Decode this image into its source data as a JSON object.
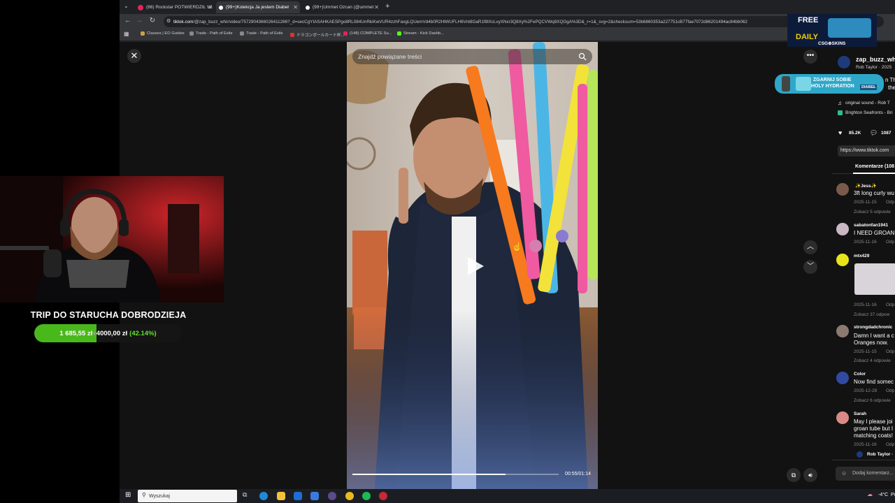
{
  "browser": {
    "tabs": [
      {
        "label": "(86) Rockstar POTWIERDZIŁ Wi",
        "icon_color": "#e0245e"
      },
      {
        "label": "(99+)Kolekcja Ja jestem Diabeł",
        "icon_color": "#ffffff"
      },
      {
        "label": "(99+)Ummet Ozcan (@ummet",
        "icon_color": "#ffffff"
      }
    ],
    "url_host": "tiktok.com",
    "url_path": "/@zap_buzz_whir/video/7572904366026411286?_d=secCgYIASAHKAESPgo8RL084UnRkiKwVUR4zzhFaxgLQUemVd4b0R2HlWUFLH6Vnt8GaR1f8lXcLvyXNxr3Q8Xy%2FePQCVWq9XQGgA%3D&_r=1&_svg=2&checksum=53b6860353a227751cB77fae7072d86201494ac84bb062",
    "bookmarks": [
      "Classes | EO Guides",
      "Trade - Path of Exile",
      "Trade - Path of Exile",
      "ドラゴンボールカード杯...",
      "(148) COMPLETE Su...",
      "Stream - Kick Dashb..."
    ]
  },
  "tiktok": {
    "search_placeholder": "Znajdź powiązane treści",
    "video_time": "00:55/01:14",
    "progress_fraction": 0.743,
    "author_handle": "zap_buzz_whi",
    "author_name": "Rob Taylor · 2025",
    "caption_fragment": "n Th",
    "caption_fragment2": "the",
    "sound": "original sound - Rob T",
    "location": "Brighton Seafronts - Bri",
    "likes": "85.2K",
    "comments_count": "1087",
    "share_url": "https://www.tiktok.com",
    "comments_tab": "Komentarze (108",
    "comments": [
      {
        "user": "✨Jess✨",
        "text": [
          "3ft long curly wu"
        ],
        "date": "2025-11-15",
        "reply": "Odp",
        "more": "Zobacz 5 odpowie",
        "avatar": "#7a5a4a"
      },
      {
        "user": "sabatonfan1941",
        "text": [
          "I NEED GROAN T"
        ],
        "date": "2025-11-16",
        "reply": "Odp",
        "more": "",
        "avatar": "#c9b7c4"
      },
      {
        "user": "mtx429",
        "text": [],
        "date": "2025-11-16",
        "reply": "Odp",
        "more": "Zobacz 37 odpow",
        "avatar": "#e8e41a"
      },
      {
        "user": "strongdadchronic",
        "text": [
          "Damn I want a c",
          "Oranges now."
        ],
        "date": "2025-11-15",
        "reply": "Odp",
        "more": "Zobacz 4 odpowie",
        "avatar": "#8c7a70"
      },
      {
        "user": "Color",
        "text": [
          "Now find somec"
        ],
        "date": "2025-12-28",
        "reply": "Odp",
        "more": "Zobacz 6 odpowie",
        "avatar": "#2f4aa0"
      },
      {
        "user": "Sarah",
        "text": [
          "May I please joi",
          "groan tube but I",
          "matching coats!"
        ],
        "date": "2025-11-16",
        "reply": "Odp",
        "more": "",
        "avatar": "#d98a86"
      }
    ],
    "reply_author": "Rob Taylor ·",
    "add_comment": "Dodaj komentarz..."
  },
  "stream_overlay": {
    "goal_title": "TRIP DO STARUCHA DOBRODZIEJA",
    "goal_current": "1 685,55 zł",
    "goal_separator": "z",
    "goal_target": "4000,00 zł",
    "goal_percent": "(42.14%)",
    "goal_fraction": 0.4214
  },
  "ads": {
    "free_daily": [
      "FREE",
      "DAILY"
    ],
    "csg": "CSG⊕SKINS",
    "groan": [
      "ZGARNIJ SOBIE",
      "HOLY HYDRATION"
    ],
    "groan_brand": "DIABEŁ"
  },
  "taskbar": {
    "search_placeholder": "Wyszukaj",
    "weather": "-4°C",
    "weather_suffix": "Pc"
  }
}
